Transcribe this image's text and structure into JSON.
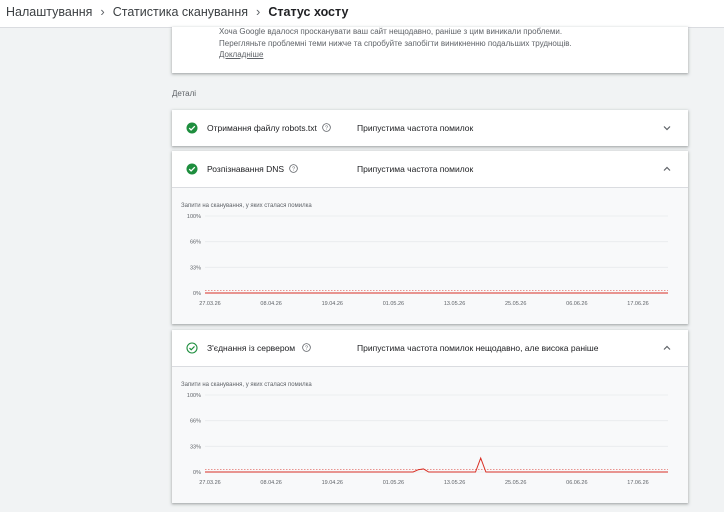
{
  "breadcrumb": [
    "Налаштування",
    "Статистика сканування",
    "Статус хосту"
  ],
  "breadcrumb_sep": "›",
  "notice": {
    "text": "Хоча Google вдалося просканувати ваш сайт нещодавно, раніше з цим виникали проблеми. Перегляньте проблемні теми нижче та спробуйте запобігти виникненню подальших труднощів.",
    "link": "Докладніше"
  },
  "section_label": "Деталі",
  "items": [
    {
      "label": "Отримання файлу robots.txt",
      "status": "Припустима частота помилок",
      "icon": "check-filled-icon",
      "expanded": false
    },
    {
      "label": "Розпізнавання DNS",
      "status": "Припустима частота помилок",
      "icon": "check-filled-icon",
      "expanded": true
    },
    {
      "label": "З'єднання із сервером",
      "status": "Припустима частота помилок нещодавно, але висока раніше",
      "icon": "check-outline-icon",
      "expanded": true
    }
  ],
  "colors": {
    "accent": "#1e8e3e",
    "line": "#d93025",
    "grid": "#e8eaed"
  },
  "chart_data": [
    {
      "type": "line",
      "title": "Запити на сканування, у яких сталася помилка",
      "yticks": [
        "100%",
        "66%",
        "33%",
        "0%"
      ],
      "xticks": [
        "27.03.26",
        "08.04.26",
        "19.04.26",
        "01.05.26",
        "13.05.26",
        "25.05.26",
        "06.06.26",
        "17.06.26"
      ],
      "ylim": [
        0,
        100
      ],
      "y_unit": "%",
      "series": [
        {
          "values": [
            0,
            0,
            0,
            0,
            0,
            0,
            0,
            0,
            0,
            0,
            0,
            0,
            0,
            0,
            0,
            0,
            0,
            0,
            0,
            0,
            0,
            0,
            0,
            0,
            0,
            0,
            0,
            0,
            0,
            0,
            0,
            0,
            0,
            0,
            0,
            0,
            0,
            0,
            0,
            0,
            0,
            0,
            0,
            0,
            0,
            0,
            0,
            0,
            0,
            0,
            0,
            0,
            0,
            0,
            0,
            0,
            0,
            0,
            0,
            0,
            0,
            0,
            0,
            0,
            0,
            0,
            0,
            0,
            0,
            0,
            0,
            0,
            0,
            0,
            0,
            0,
            0,
            0,
            0,
            0,
            0,
            0,
            0,
            0,
            0,
            0,
            0,
            0,
            0,
            0
          ]
        }
      ]
    },
    {
      "type": "line",
      "title": "Запити на сканування, у яких сталася помилка",
      "yticks": [
        "100%",
        "66%",
        "33%",
        "0%"
      ],
      "xticks": [
        "27.03.26",
        "08.04.26",
        "19.04.26",
        "01.05.26",
        "13.05.26",
        "25.05.26",
        "06.06.26",
        "17.06.26"
      ],
      "ylim": [
        0,
        100
      ],
      "y_unit": "%",
      "series": [
        {
          "values": [
            0,
            0,
            0,
            0,
            0,
            0,
            0,
            0,
            0,
            0,
            0,
            0,
            0,
            0,
            0,
            0,
            0,
            0,
            0,
            0,
            0,
            0,
            0,
            0,
            0,
            0,
            0,
            0,
            0,
            0,
            0,
            0,
            0,
            0,
            0,
            0,
            0,
            0,
            0,
            0,
            0,
            3,
            4,
            0,
            0,
            0,
            0,
            0,
            0,
            0,
            0,
            0,
            0,
            18,
            0,
            0,
            0,
            0,
            0,
            0,
            0,
            0,
            0,
            0,
            0,
            0,
            0,
            0,
            0,
            0,
            0,
            0,
            0,
            0,
            0,
            0,
            0,
            0,
            0,
            0,
            0,
            0,
            0,
            0,
            0,
            0,
            0,
            0,
            0,
            0
          ]
        }
      ]
    }
  ]
}
